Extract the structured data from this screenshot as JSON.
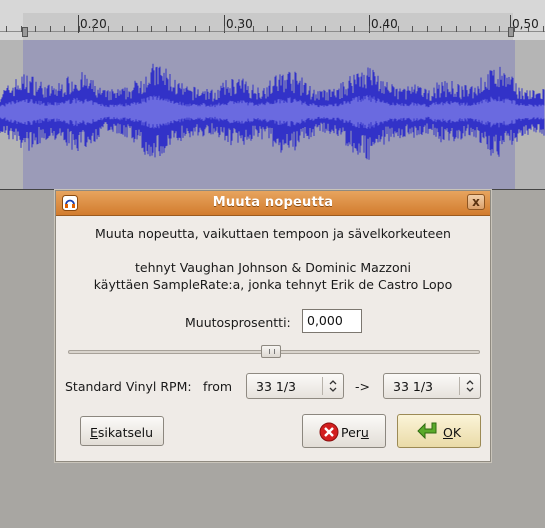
{
  "ruler": {
    "labels": [
      "0.20",
      "0.30",
      "0.40",
      "0,50"
    ]
  },
  "dialog": {
    "title": "Muuta nopeutta",
    "description": "Muuta nopeutta, vaikuttaen tempoon ja sävelkorkeuteen",
    "credit_line_1": "tehnyt Vaughan Johnson & Dominic Mazzoni",
    "credit_line_2": "käyttäen SampleRate:a, jonka tehnyt Erik de Castro Lopo",
    "percent_label": "Muutosprosentti:",
    "percent_value": "0,000",
    "vinyl_label": "Standard Vinyl RPM:",
    "from_label": "from",
    "from_value": "33 1/3",
    "to_arrow": "->",
    "to_value": "33 1/3",
    "preview_button": {
      "first": "E",
      "rest": "sikatselu"
    },
    "cancel_button": {
      "start": "Per",
      "accel": "u"
    },
    "ok_button": {
      "accel": "O",
      "rest": "K"
    },
    "close_glyph": "x"
  },
  "colors": {
    "waveform": "#3232c8",
    "selection": "#9b9bb8",
    "titlebar": "#d9863a"
  }
}
